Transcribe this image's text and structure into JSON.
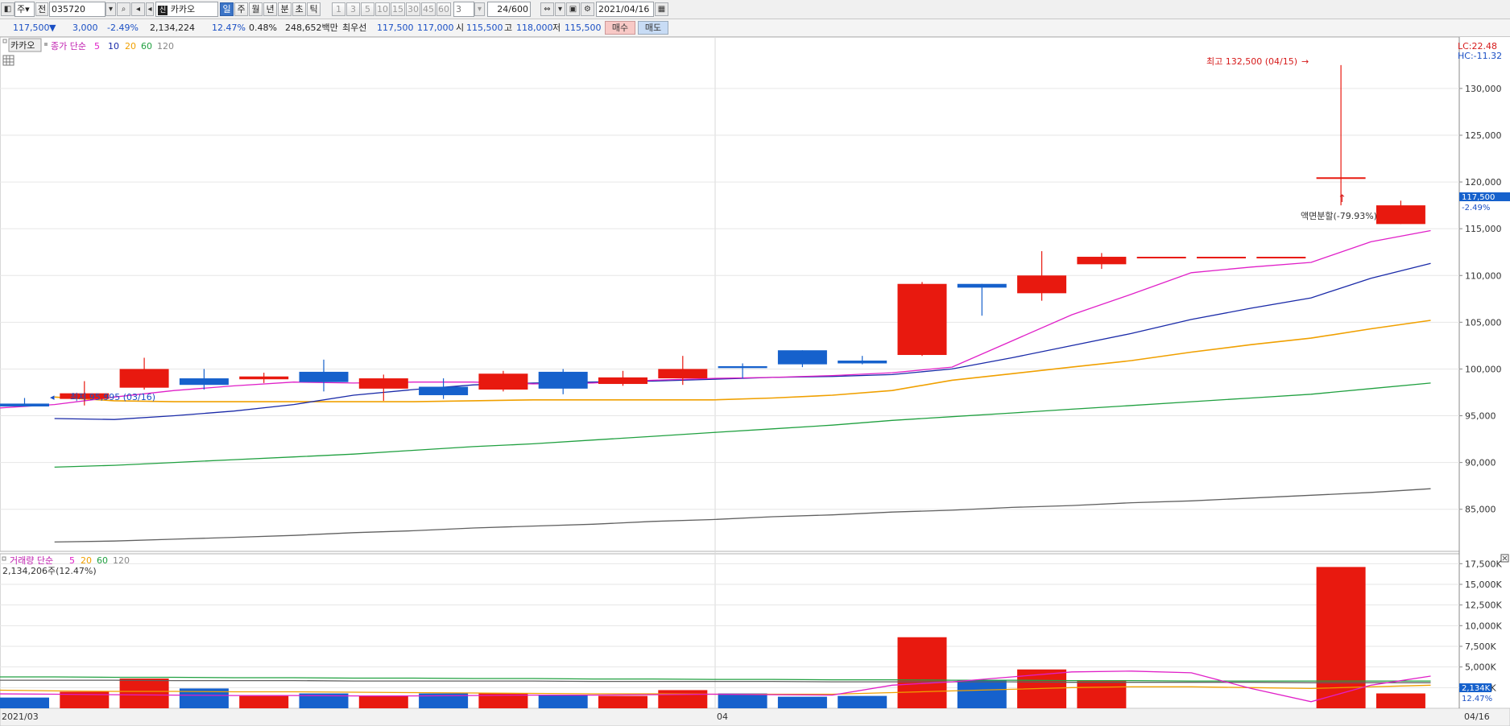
{
  "toolbar": {
    "market_btn": "주",
    "prev_btn": "전",
    "code": "035720",
    "name": "카카오",
    "name_badge": "신",
    "period_tabs": [
      "일",
      "주",
      "월",
      "년",
      "분",
      "초",
      "틱"
    ],
    "active_period": "일",
    "interval_buttons": [
      "1",
      "3",
      "5",
      "10",
      "15",
      "30",
      "45",
      "60"
    ],
    "interval_value": "3",
    "count": "24",
    "count_total": "/600",
    "date": "2021/04/16"
  },
  "quote": {
    "price": "117,500",
    "arrow": "▼",
    "change": "3,000",
    "change_pct": "-2.49%",
    "volume": "2,134,224",
    "turnover_pct": "12.47%",
    "pct2": "0.48%",
    "amount": "248,652백만",
    "best_bid_label": "최우선",
    "best_ask": "117,500",
    "best_bid": "117,000",
    "open_label": "시",
    "open": "115,500",
    "high_label": "고",
    "high": "118,000",
    "low_label": "저",
    "low": "115,500",
    "buy_label": "매수",
    "sell_label": "매도"
  },
  "price_legend": {
    "name": "카카오",
    "label": "종가 단순",
    "periods": [
      "5",
      "10",
      "20",
      "60",
      "120"
    ]
  },
  "volume_legend": {
    "label": "거래량 단순",
    "periods": [
      "5",
      "20",
      "60",
      "120"
    ],
    "info": "2,134,206주(12.47%)"
  },
  "lc_hc": {
    "lc": "LC:22.48",
    "hc": "HC:-11.32"
  },
  "price_tag": {
    "value": "117,500",
    "pct": "-2.49%"
  },
  "vol_tag": {
    "value": "2,134K",
    "pct": "12.47%"
  },
  "annotations": {
    "high": "최고 132,500 (04/15)",
    "low": "최저 95,995 (03/16)",
    "split": "액면분할(-79.93%)"
  },
  "x_labels": {
    "start": "2021/03",
    "mid": "04",
    "end": "04/16"
  },
  "colors": {
    "up": "#e8190f",
    "down": "#1661cc",
    "ma5": "#e020c8",
    "ma10": "#1a2aa8",
    "ma20": "#f0a000",
    "ma60": "#20a040",
    "ma120": "#606060"
  },
  "chart_data": {
    "type": "candlestick",
    "price_axis": {
      "ylim": [
        80500,
        135500
      ],
      "ticks": [
        "85,000",
        "90,000",
        "95,000",
        "100,000",
        "105,000",
        "110,000",
        "115,000",
        "120,000",
        "125,000",
        "130,000"
      ]
    },
    "volume_axis": {
      "ylim": [
        0,
        18700
      ],
      "ticks": [
        "2,500K",
        "5,000K",
        "7,500K",
        "10,000K",
        "12,500K",
        "15,000K",
        "17,500K"
      ]
    },
    "candles": [
      {
        "o": 96300,
        "h": 96900,
        "l": 95995,
        "c": 95995
      },
      {
        "o": 96800,
        "h": 98700,
        "l": 96100,
        "c": 97400
      },
      {
        "o": 98000,
        "h": 101200,
        "l": 97800,
        "c": 100000
      },
      {
        "o": 99000,
        "h": 100000,
        "l": 97800,
        "c": 98300
      },
      {
        "o": 98900,
        "h": 99600,
        "l": 98500,
        "c": 99200
      },
      {
        "o": 99700,
        "h": 101000,
        "l": 97600,
        "c": 98600
      },
      {
        "o": 97900,
        "h": 99400,
        "l": 96600,
        "c": 99000
      },
      {
        "o": 98100,
        "h": 99000,
        "l": 96800,
        "c": 97200
      },
      {
        "o": 97800,
        "h": 99800,
        "l": 97600,
        "c": 99500
      },
      {
        "o": 99700,
        "h": 100000,
        "l": 97300,
        "c": 97900
      },
      {
        "o": 98400,
        "h": 99800,
        "l": 98200,
        "c": 99100
      },
      {
        "o": 99000,
        "h": 101400,
        "l": 98300,
        "c": 100000
      },
      {
        "o": 100300,
        "h": 100600,
        "l": 99000,
        "c": 100100
      },
      {
        "o": 102000,
        "h": 102000,
        "l": 100200,
        "c": 100500
      },
      {
        "o": 100900,
        "h": 101400,
        "l": 100500,
        "c": 100600
      },
      {
        "o": 101500,
        "h": 109300,
        "l": 101400,
        "c": 109100
      },
      {
        "o": 109100,
        "h": 109100,
        "l": 105700,
        "c": 108700
      },
      {
        "o": 108100,
        "h": 112600,
        "l": 107300,
        "c": 110000
      },
      {
        "o": 111200,
        "h": 112400,
        "l": 110700,
        "c": 112000
      },
      {
        "o": 112000,
        "h": 112000,
        "l": 112000,
        "c": 112000
      },
      {
        "o": 112000,
        "h": 112000,
        "l": 112000,
        "c": 112000
      },
      {
        "o": 112000,
        "h": 112000,
        "l": 112000,
        "c": 112000
      },
      {
        "o": 120500,
        "h": 132500,
        "l": 117500,
        "c": 120500
      },
      {
        "o": 115500,
        "h": 118000,
        "l": 115500,
        "c": 117500
      }
    ],
    "volume": [
      1300,
      2000,
      3600,
      2400,
      1500,
      1800,
      1500,
      1800,
      1800,
      1600,
      1500,
      2200,
      1800,
      1400,
      1500,
      8600,
      3400,
      4700,
      3300,
      0,
      0,
      0,
      17100,
      1800
    ],
    "ma5": [
      95800,
      96200,
      97000,
      97700,
      98200,
      98600,
      98500,
      98600,
      98600,
      98400,
      98500,
      98800,
      99000,
      99100,
      99300,
      99600,
      100200,
      103000,
      105800,
      108000,
      110300,
      110900,
      111400,
      113600,
      114800
    ],
    "ma10": [
      null,
      94700,
      94600,
      95000,
      95500,
      96200,
      97200,
      97800,
      98300,
      98500,
      98600,
      98700,
      98900,
      99100,
      99200,
      99400,
      100000,
      101200,
      102500,
      103800,
      105300,
      106500,
      107600,
      109700,
      111300
    ],
    "ma20": [
      null,
      97000,
      96600,
      96500,
      96500,
      96500,
      96500,
      96500,
      96600,
      96700,
      96700,
      96700,
      96700,
      96900,
      97200,
      97700,
      98800,
      99500,
      100200,
      100900,
      101800,
      102600,
      103300,
      104300,
      105200
    ],
    "ma60": [
      null,
      89500,
      89700,
      90000,
      90300,
      90600,
      90900,
      91300,
      91700,
      92000,
      92400,
      92800,
      93200,
      93600,
      94000,
      94500,
      94900,
      95300,
      95700,
      96100,
      96500,
      96900,
      97300,
      97900,
      98500
    ],
    "ma120": [
      null,
      81500,
      81600,
      81800,
      82000,
      82200,
      82500,
      82700,
      83000,
      83200,
      83400,
      83700,
      83900,
      84200,
      84400,
      84700,
      84900,
      85200,
      85400,
      85700,
      85900,
      86200,
      86500,
      86800,
      87200
    ],
    "vol_ma5": [
      1750,
      1700,
      1650,
      1600,
      1550,
      1550,
      1500,
      1500,
      1550,
      1600,
      1600,
      1650,
      1700,
      1650,
      1600,
      2800,
      3200,
      3800,
      4400,
      4500,
      4300,
      2400,
      800,
      2800,
      3900
    ],
    "vol_ma20": [
      2200,
      2100,
      2050,
      2050,
      2000,
      2000,
      1950,
      1900,
      1850,
      1800,
      1750,
      1750,
      1700,
      1700,
      1700,
      1900,
      2100,
      2300,
      2500,
      2600,
      2600,
      2500,
      2400,
      2600,
      2800
    ],
    "vol_ma60": [
      3800,
      3800,
      3750,
      3750,
      3700,
      3700,
      3650,
      3650,
      3600,
      3600,
      3550,
      3550,
      3500,
      3500,
      3450,
      3450,
      3400,
      3400,
      3350,
      3350,
      3300,
      3300,
      3300,
      3300,
      3300
    ],
    "vol_ma120": [
      3400,
      3400,
      3400,
      3350,
      3350,
      3350,
      3300,
      3300,
      3300,
      3300,
      3250,
      3250,
      3250,
      3250,
      3200,
      3200,
      3200,
      3200,
      3150,
      3150,
      3150,
      3150,
      3100,
      3100,
      3100
    ]
  }
}
